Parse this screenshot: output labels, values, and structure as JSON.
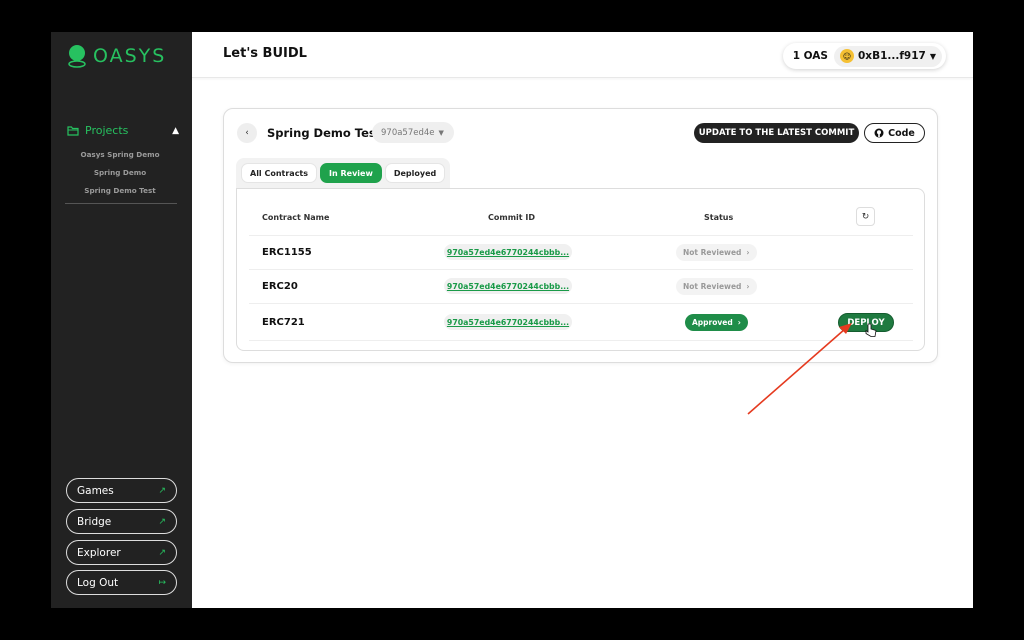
{
  "sidebar": {
    "logo_text": "OASYS",
    "projects_label": "Projects",
    "sub_items": [
      "Oasys Spring Demo",
      "Spring Demo",
      "Spring Demo Test"
    ],
    "bottom_buttons": [
      {
        "label": "Games"
      },
      {
        "label": "Bridge"
      },
      {
        "label": "Explorer"
      },
      {
        "label": "Log Out"
      }
    ]
  },
  "header": {
    "title": "Let's BUIDL",
    "balance": "1 OAS",
    "address": "0xB1...f917"
  },
  "project": {
    "title": "Spring Demo Test",
    "commit_selected": "970a57ed4e",
    "update_label": "UPDATE TO THE LATEST COMMIT",
    "code_label": "Code",
    "tabs": [
      "All Contracts",
      "In Review",
      "Deployed"
    ],
    "active_tab": "In Review",
    "columns": {
      "name": "Contract Name",
      "commit": "Commit ID",
      "status": "Status"
    },
    "rows": [
      {
        "name": "ERC1155",
        "commit": "970a57ed4e6770244cbbb...",
        "status": "Not Reviewed"
      },
      {
        "name": "ERC20",
        "commit": "970a57ed4e6770244cbbb...",
        "status": "Not Reviewed"
      },
      {
        "name": "ERC721",
        "commit": "970a57ed4e6770244cbbb...",
        "status": "Approved",
        "action": "DEPLOY"
      }
    ]
  },
  "colors": {
    "accent_green": "#1fa24c",
    "sidebar_bg": "#222222",
    "annotation_arrow": "#e53a1f"
  }
}
